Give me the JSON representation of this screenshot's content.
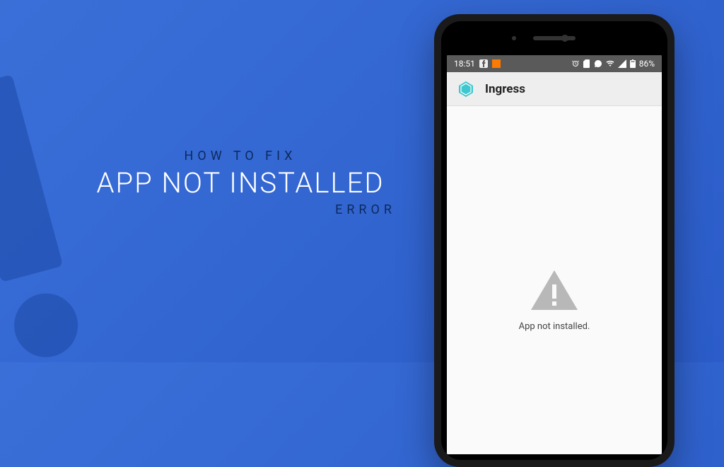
{
  "headline": {
    "line1": "HOW TO FIX",
    "line2": "APP NOT INSTALLED",
    "line3": "ERROR"
  },
  "statusbar": {
    "time": "18:51",
    "battery_pct": "86%"
  },
  "appbar": {
    "title": "Ingress"
  },
  "content": {
    "error_message": "App not installed."
  }
}
